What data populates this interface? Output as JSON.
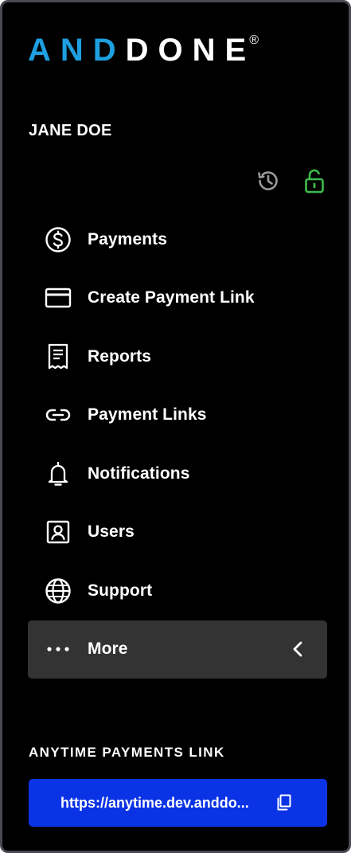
{
  "brand": {
    "logo_part1": "AND",
    "logo_part2": "DONE",
    "registered_mark": "®",
    "accent_color": "#1e9fe0"
  },
  "user": {
    "name": "JANE DOE"
  },
  "toolbar": {
    "history_icon": "history-icon",
    "lock_icon": "unlock-icon",
    "lock_color": "#3dbb4e"
  },
  "nav": {
    "items": [
      {
        "label": "Payments",
        "icon": "dollar-circle-icon"
      },
      {
        "label": "Create Payment Link",
        "icon": "credit-card-icon"
      },
      {
        "label": "Reports",
        "icon": "report-icon"
      },
      {
        "label": "Payment Links",
        "icon": "link-icon"
      },
      {
        "label": "Notifications",
        "icon": "bell-icon"
      },
      {
        "label": "Users",
        "icon": "user-badge-icon"
      },
      {
        "label": "Support",
        "icon": "globe-icon"
      },
      {
        "label": "More",
        "icon": "more-dots-icon"
      }
    ],
    "active_index": 7
  },
  "anytime": {
    "title": "ANYTIME PAYMENTS LINK",
    "link": "https://anytime.dev.anddo...",
    "button_color": "#0b33e6"
  }
}
